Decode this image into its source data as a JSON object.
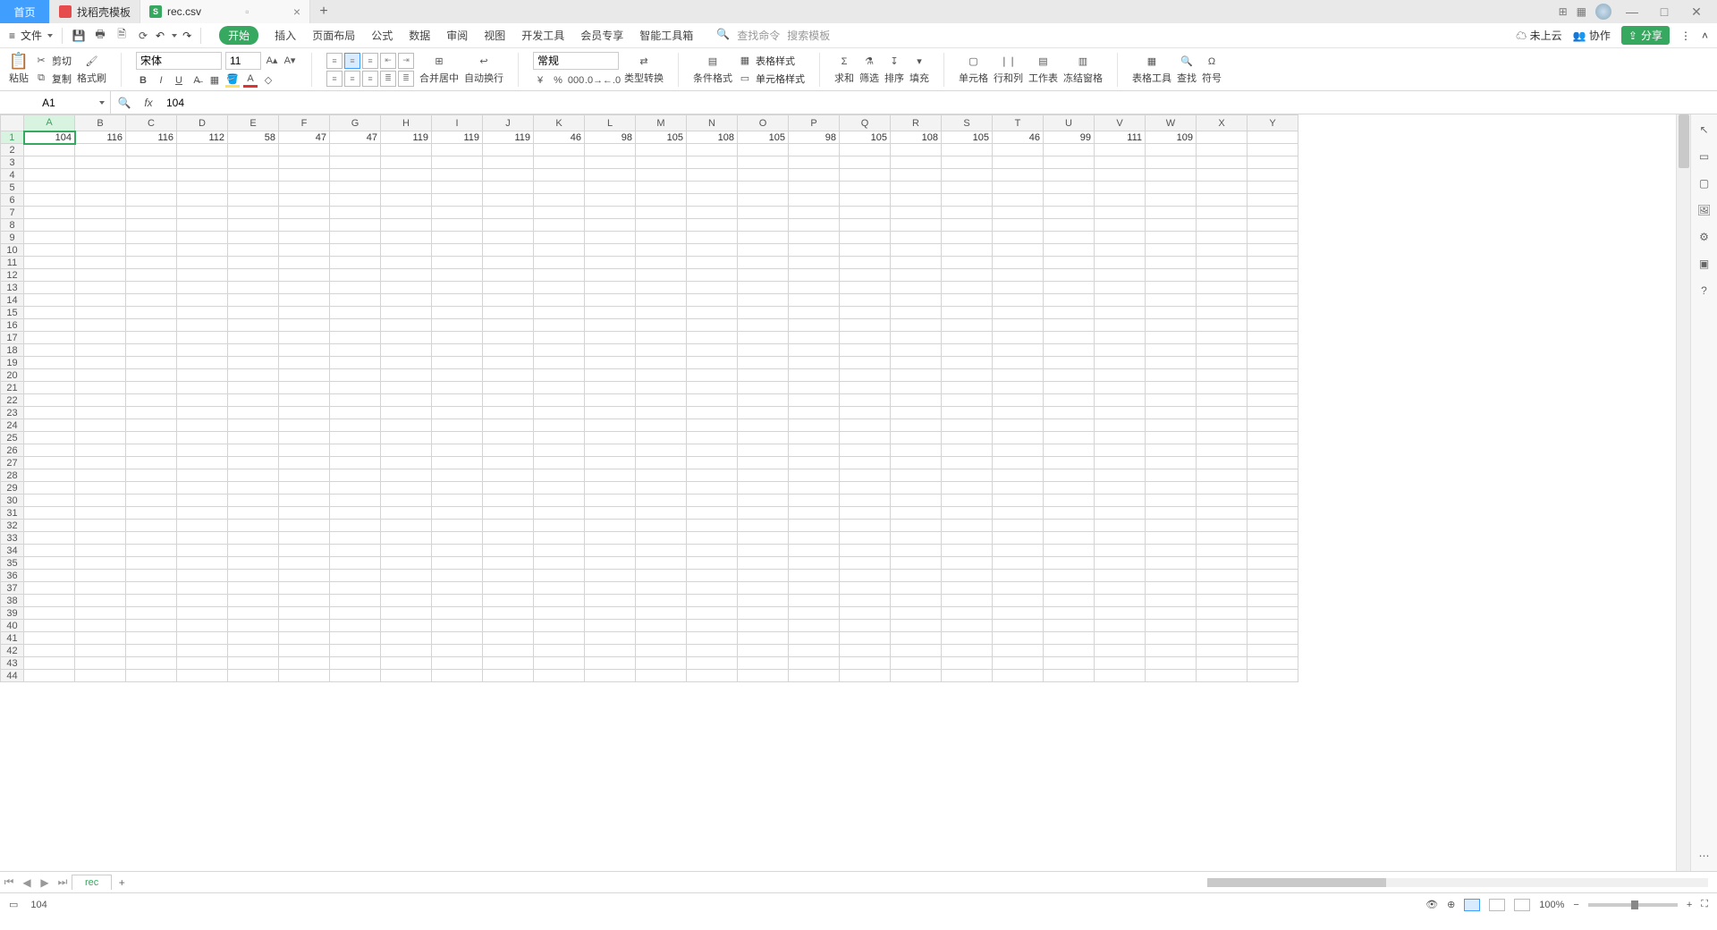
{
  "titlebar": {
    "home_tab": "首页",
    "template_tab": "找稻壳模板",
    "file_tab": "rec.csv",
    "close": "×",
    "add": "+",
    "right_icons": {
      "multi": "⊞",
      "grid": "▦"
    }
  },
  "window": {
    "min": "—",
    "max": "□",
    "close": "✕"
  },
  "menubar": {
    "file_btn": "文件",
    "qat": [
      "save-icon",
      "print-icon",
      "preview-icon",
      "refresh-icon"
    ],
    "undo": "↶",
    "redo": "↷",
    "tabs": [
      "开始",
      "插入",
      "页面布局",
      "公式",
      "数据",
      "审阅",
      "视图",
      "开发工具",
      "会员专享",
      "智能工具箱"
    ],
    "search_placeholder_1": "查找命令",
    "search_placeholder_2": "搜索模板",
    "cloud": "未上云",
    "collab": "协作",
    "share": "分享"
  },
  "ribbon": {
    "paste": "粘贴",
    "cut": "剪切",
    "copy": "复制",
    "format_painter": "格式刷",
    "font_name": "宋体",
    "font_size": "11",
    "number_format": "常规",
    "merge": "合并居中",
    "wrap": "自动换行",
    "type_convert": "类型转换",
    "cond_format": "条件格式",
    "cell_style": "单元格样式",
    "table_style": "表格样式",
    "sum": "求和",
    "filter": "筛选",
    "sort": "排序",
    "fill": "填充",
    "cells_btn": "单元格",
    "row_col": "行和列",
    "worksheet": "工作表",
    "freeze": "冻结窗格",
    "table_tools": "表格工具",
    "find": "查找",
    "symbol": "符号"
  },
  "fx": {
    "namebox": "A1",
    "formula": "104"
  },
  "columns": [
    "A",
    "B",
    "C",
    "D",
    "E",
    "F",
    "G",
    "H",
    "I",
    "J",
    "K",
    "L",
    "M",
    "N",
    "O",
    "P",
    "Q",
    "R",
    "S",
    "T",
    "U",
    "V",
    "W",
    "X",
    "Y"
  ],
  "row_count": 44,
  "active_cell": {
    "row": 1,
    "col": 0
  },
  "data_row1": [
    104,
    116,
    116,
    112,
    58,
    47,
    47,
    119,
    119,
    119,
    46,
    98,
    105,
    108,
    105,
    98,
    105,
    108,
    105,
    46,
    99,
    111,
    109,
    "",
    ""
  ],
  "sheet_tabs": {
    "name": "rec",
    "add": "+"
  },
  "statusbar": {
    "left_value": "104",
    "zoom": "100%",
    "minus": "−",
    "plus": "+"
  },
  "chart_data": {
    "type": "table",
    "title": "rec.csv row 1",
    "columns": [
      "A",
      "B",
      "C",
      "D",
      "E",
      "F",
      "G",
      "H",
      "I",
      "J",
      "K",
      "L",
      "M",
      "N",
      "O",
      "P",
      "Q",
      "R",
      "S",
      "T",
      "U",
      "V",
      "W"
    ],
    "values": [
      104,
      116,
      116,
      112,
      58,
      47,
      47,
      119,
      119,
      119,
      46,
      98,
      105,
      108,
      105,
      98,
      105,
      108,
      105,
      46,
      99,
      111,
      109
    ]
  }
}
